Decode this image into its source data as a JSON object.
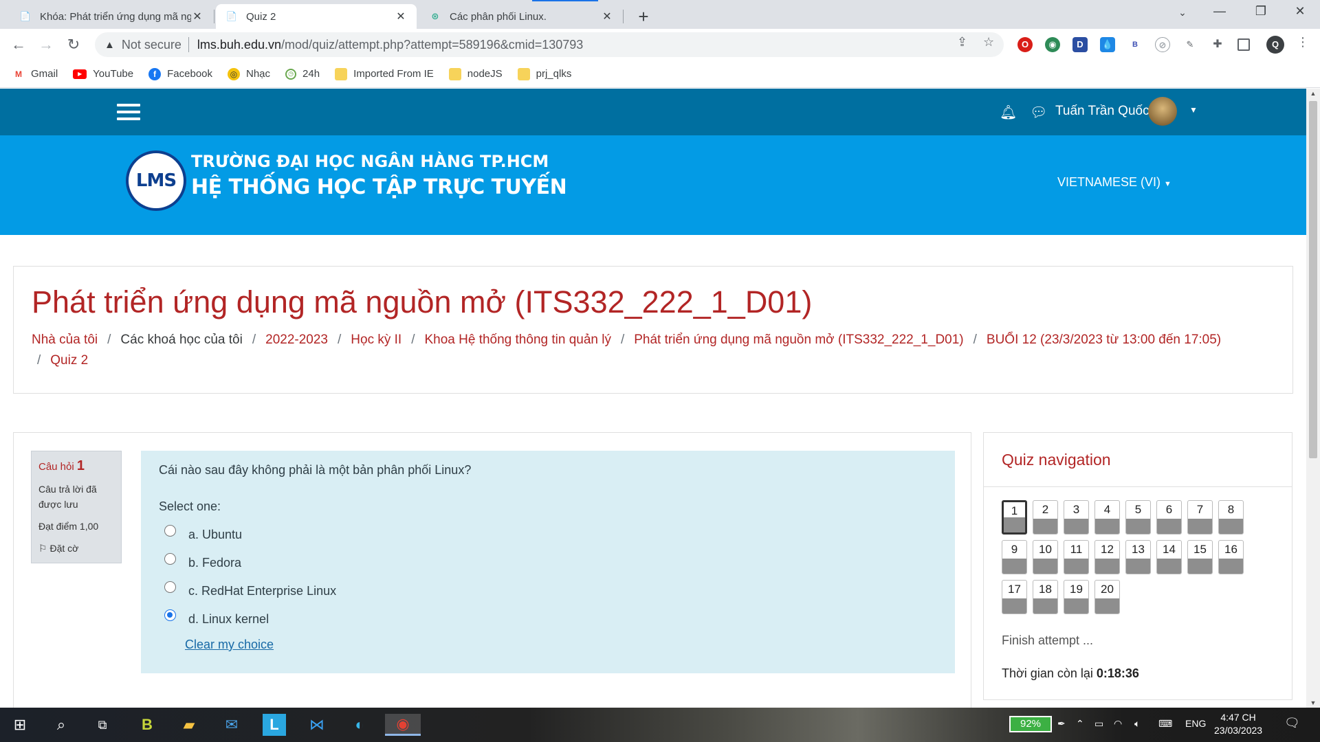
{
  "browser": {
    "tabs": [
      {
        "title": "Khóa: Phát triển ứng dụng mã nguồn mở",
        "active": false
      },
      {
        "title": "Quiz 2",
        "active": true
      },
      {
        "title": "Các phân phối Linux.",
        "active": false
      }
    ],
    "security_label": "Not secure",
    "url_host": "lms.buh.edu.vn",
    "url_path": "/mod/quiz/attempt.php?attempt=589196&cmid=130793",
    "profile_initial": "Q",
    "bookmarks": [
      "Gmail",
      "YouTube",
      "Facebook",
      "Nhạc",
      "24h",
      "Imported From IE",
      "nodeJS",
      "prj_qlks"
    ]
  },
  "site": {
    "user_name": "Tuấn Trần Quốc",
    "logo_text": "LMS",
    "brand_line1": "TRƯỜNG ĐẠI HỌC NGÂN HÀNG TP.HCM",
    "brand_line2": "HỆ THỐNG HỌC TẬP TRỰC TUYẾN",
    "language": "VIETNAMESE (VI)",
    "nav_color": "#006fa0",
    "banner_color": "#039be5",
    "accent_color": "#b22525"
  },
  "page": {
    "course_title": "Phát triển ứng dụng mã nguồn mở (ITS332_222_1_D01)",
    "breadcrumb": [
      "Nhà của tôi",
      "Các khoá học của tôi",
      "2022-2023",
      "Học kỳ II",
      "Khoa Hệ thống thông tin quản lý",
      "Phát triển ứng dụng mã nguồn mở (ITS332_222_1_D01)",
      "BUỔI 12 (23/3/2023 từ 13:00 đến 17:05)",
      "Quiz 2"
    ]
  },
  "question": {
    "label": "Câu hỏi",
    "number": "1",
    "status": "Câu trả lời đã được lưu",
    "mark": "Đạt điểm 1,00",
    "flag": "Đặt cờ",
    "text": "Cái nào sau đây không phải là một bản phân phối Linux?",
    "prompt": "Select one:",
    "options": [
      "a. Ubuntu",
      "b. Fedora",
      "c. RedHat Enterprise Linux",
      "d. Linux kernel"
    ],
    "selected_index": 3,
    "clear_label": "Clear my choice"
  },
  "quiz_nav": {
    "title": "Quiz navigation",
    "buttons": [
      "1",
      "2",
      "3",
      "4",
      "5",
      "6",
      "7",
      "8",
      "9",
      "10",
      "11",
      "12",
      "13",
      "14",
      "15",
      "16",
      "17",
      "18",
      "19",
      "20"
    ],
    "current": "1",
    "finish_label": "Finish attempt ...",
    "timer_label": "Thời gian còn lại",
    "timer_value": "0:18:36"
  },
  "taskbar": {
    "battery": "92%",
    "language": "ENG",
    "time": "4:47 CH",
    "date": "23/03/2023"
  }
}
